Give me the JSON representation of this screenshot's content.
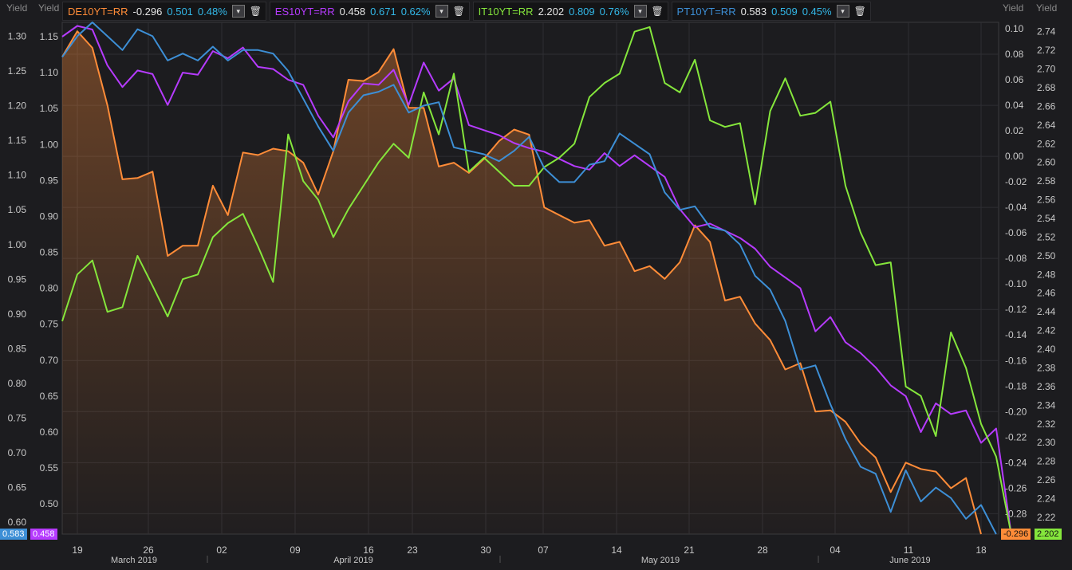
{
  "legend": [
    {
      "symbol": "DE10YT=RR",
      "last": "-0.296",
      "chg": "0.501",
      "pct": "0.48%",
      "color": "#ff8c38"
    },
    {
      "symbol": "ES10YT=RR",
      "last": "0.458",
      "chg": "0.671",
      "pct": "0.62%",
      "color": "#b63bff"
    },
    {
      "symbol": "IT10YT=RR",
      "last": "2.202",
      "chg": "0.809",
      "pct": "0.76%",
      "color": "#85e63c"
    },
    {
      "symbol": "PT10YT=RR",
      "last": "0.583",
      "chg": "0.509",
      "pct": "0.45%",
      "color": "#3d8fd6"
    }
  ],
  "axis_titles": {
    "y1": "Yield",
    "y2": "Yield",
    "y3": "Yield",
    "y4": "Yield"
  },
  "tags": {
    "pt": "0.583",
    "es": "0.458",
    "de": "-0.296",
    "it": "2.202"
  },
  "chart_data": {
    "type": "line",
    "x_ticks": [
      "19",
      "26",
      "02",
      "09",
      "16",
      "23",
      "30",
      "07",
      "14",
      "21",
      "28",
      "04",
      "11",
      "18"
    ],
    "x_groups": [
      "March 2019",
      "April 2019",
      "May 2019",
      "June 2019"
    ],
    "grid": true,
    "axes": {
      "pt": {
        "ticks": [
          "1.30",
          "1.25",
          "1.20",
          "1.15",
          "1.10",
          "1.05",
          "1.00",
          "0.95",
          "0.90",
          "0.85",
          "0.80",
          "0.75",
          "0.70",
          "0.65",
          "0.60"
        ],
        "min": 0.583,
        "max": 1.32
      },
      "es": {
        "ticks": [
          "1.15",
          "1.10",
          "1.05",
          "1.00",
          "0.95",
          "0.90",
          "0.85",
          "0.80",
          "0.75",
          "0.70",
          "0.65",
          "0.60",
          "0.55",
          "0.50"
        ],
        "min": 0.458,
        "max": 1.17
      },
      "de": {
        "ticks": [
          "0.10",
          "0.08",
          "0.06",
          "0.04",
          "0.02",
          "0.00",
          "-0.02",
          "-0.04",
          "-0.06",
          "-0.08",
          "-0.10",
          "-0.12",
          "-0.14",
          "-0.16",
          "-0.18",
          "-0.20",
          "-0.22",
          "-0.24",
          "-0.26",
          "-0.28"
        ],
        "min": -0.296,
        "max": 0.105
      },
      "it": {
        "ticks": [
          "2.74",
          "2.72",
          "2.70",
          "2.68",
          "2.66",
          "2.64",
          "2.62",
          "2.60",
          "2.58",
          "2.56",
          "2.54",
          "2.52",
          "2.50",
          "2.48",
          "2.46",
          "2.44",
          "2.42",
          "2.40",
          "2.38",
          "2.36",
          "2.34",
          "2.32",
          "2.30",
          "2.28",
          "2.26",
          "2.24",
          "2.22"
        ],
        "min": 2.202,
        "max": 2.75
      }
    },
    "series": [
      {
        "name": "DE10YT=RR",
        "axis": "de",
        "color": "#ff8c38",
        "fill": true,
        "values": [
          0.078,
          0.098,
          0.085,
          0.04,
          -0.018,
          -0.017,
          -0.012,
          -0.078,
          -0.07,
          -0.07,
          -0.023,
          -0.046,
          0.003,
          0.001,
          0.006,
          0.004,
          -0.005,
          -0.03,
          0.004,
          0.06,
          0.059,
          0.066,
          0.084,
          0.038,
          0.038,
          -0.008,
          -0.005,
          -0.013,
          -0.002,
          0.012,
          0.021,
          0.017,
          -0.04,
          -0.046,
          -0.052,
          -0.05,
          -0.07,
          -0.067,
          -0.09,
          -0.086,
          -0.096,
          -0.083,
          -0.054,
          -0.067,
          -0.113,
          -0.11,
          -0.131,
          -0.144,
          -0.167,
          -0.162,
          -0.2,
          -0.199,
          -0.208,
          -0.225,
          -0.236,
          -0.263,
          -0.24,
          -0.245,
          -0.247,
          -0.26,
          -0.252,
          -0.296
        ]
      },
      {
        "name": "ES10YT=RR",
        "axis": "es",
        "color": "#b63bff",
        "values": [
          1.15,
          1.165,
          1.16,
          1.11,
          1.08,
          1.103,
          1.098,
          1.055,
          1.1,
          1.097,
          1.13,
          1.12,
          1.135,
          1.108,
          1.105,
          1.09,
          1.083,
          1.04,
          1.01,
          1.06,
          1.085,
          1.083,
          1.104,
          1.055,
          1.114,
          1.075,
          1.092,
          1.027,
          1.02,
          1.013,
          1.002,
          0.995,
          0.99,
          0.98,
          0.97,
          0.965,
          0.988,
          0.97,
          0.985,
          0.97,
          0.955,
          0.91,
          0.885,
          0.89,
          0.88,
          0.87,
          0.855,
          0.83,
          0.815,
          0.8,
          0.74,
          0.76,
          0.725,
          0.71,
          0.69,
          0.665,
          0.65,
          0.6,
          0.64,
          0.625,
          0.63,
          0.585,
          0.605,
          0.458
        ]
      },
      {
        "name": "IT10YT=RR",
        "axis": "it",
        "color": "#85e63c",
        "values": [
          2.43,
          2.48,
          2.495,
          2.44,
          2.445,
          2.5,
          2.468,
          2.435,
          2.475,
          2.48,
          2.52,
          2.535,
          2.545,
          2.51,
          2.472,
          2.63,
          2.58,
          2.56,
          2.52,
          2.55,
          2.575,
          2.6,
          2.62,
          2.605,
          2.675,
          2.63,
          2.695,
          2.59,
          2.605,
          2.59,
          2.575,
          2.575,
          2.595,
          2.605,
          2.62,
          2.67,
          2.685,
          2.695,
          2.74,
          2.745,
          2.685,
          2.675,
          2.71,
          2.645,
          2.638,
          2.642,
          2.555,
          2.655,
          2.69,
          2.65,
          2.653,
          2.665,
          2.575,
          2.525,
          2.49,
          2.493,
          2.36,
          2.35,
          2.307,
          2.418,
          2.38,
          2.32,
          2.285,
          2.202
        ]
      },
      {
        "name": "PT10YT=RR",
        "axis": "pt",
        "color": "#3d8fd6",
        "values": [
          1.27,
          1.3,
          1.32,
          1.3,
          1.28,
          1.31,
          1.3,
          1.265,
          1.275,
          1.265,
          1.285,
          1.265,
          1.28,
          1.28,
          1.275,
          1.25,
          1.21,
          1.17,
          1.135,
          1.19,
          1.215,
          1.22,
          1.23,
          1.19,
          1.2,
          1.205,
          1.14,
          1.135,
          1.13,
          1.12,
          1.135,
          1.155,
          1.11,
          1.09,
          1.09,
          1.115,
          1.12,
          1.16,
          1.145,
          1.13,
          1.075,
          1.05,
          1.055,
          1.025,
          1.02,
          1.0,
          0.955,
          0.935,
          0.89,
          0.82,
          0.826,
          0.77,
          0.72,
          0.68,
          0.67,
          0.615,
          0.675,
          0.63,
          0.65,
          0.635,
          0.605,
          0.625,
          0.583
        ]
      }
    ]
  }
}
